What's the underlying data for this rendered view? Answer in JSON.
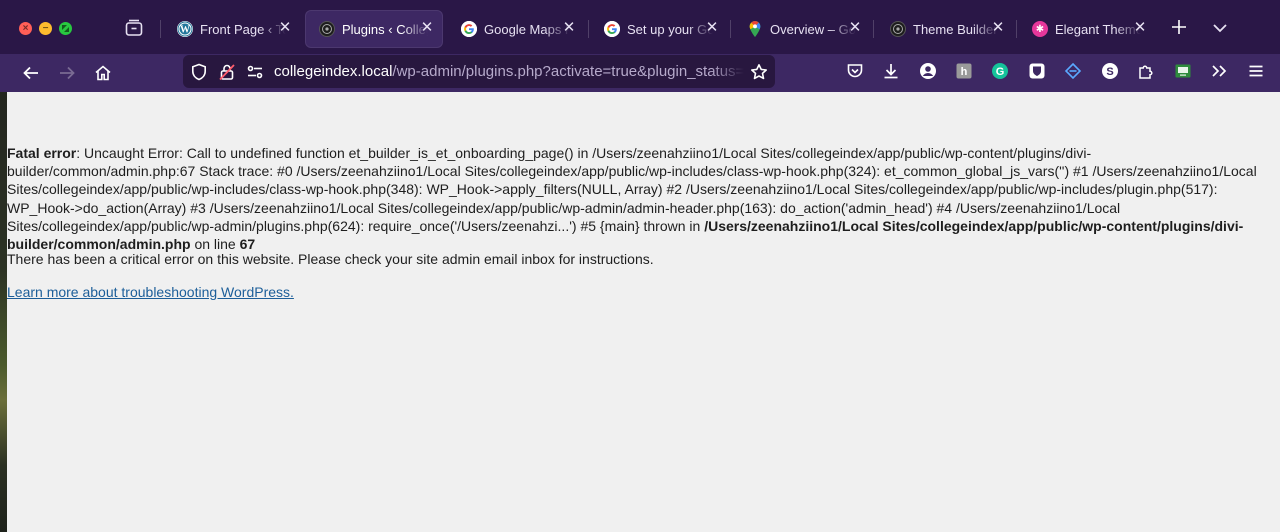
{
  "tabs": [
    {
      "label": "Front Page ‹ Temp",
      "icon": "wordpress-icon",
      "active": false
    },
    {
      "label": "Plugins ‹ College",
      "icon": "theme-icon",
      "active": true
    },
    {
      "label": "Google Maps Pla",
      "icon": "google-icon",
      "active": false
    },
    {
      "label": "Set up your Goo",
      "icon": "google-icon",
      "active": false
    },
    {
      "label": "Overview – Goo",
      "icon": "maps-pin-icon",
      "active": false
    },
    {
      "label": "Theme Builder ‹",
      "icon": "theme-icon",
      "active": false
    },
    {
      "label": "Elegant Themes",
      "icon": "elegant-themes-icon",
      "active": false
    }
  ],
  "url": {
    "host": "collegeindex.local",
    "path": "/wp-admin/plugins.php?activate=true&plugin_status=all"
  },
  "error": {
    "label": "Fatal error",
    "message": ": Uncaught Error: Call to undefined function et_builder_is_et_onboarding_page() in /Users/zeenahziino1/Local Sites/collegeindex/app/public/wp-content/plugins/divi-builder/common/admin.php:67 Stack trace: #0 /Users/zeenahziino1/Local Sites/collegeindex/app/public/wp-includes/class-wp-hook.php(324): et_common_global_js_vars('') #1 /Users/zeenahziino1/Local Sites/collegeindex/app/public/wp-includes/class-wp-hook.php(348): WP_Hook->apply_filters(NULL, Array) #2 /Users/zeenahziino1/Local Sites/collegeindex/app/public/wp-includes/plugin.php(517): WP_Hook->do_action(Array) #3 /Users/zeenahziino1/Local Sites/collegeindex/app/public/wp-admin/admin-header.php(163): do_action('admin_head') #4 /Users/zeenahziino1/Local Sites/collegeindex/app/public/wp-admin/plugins.php(624): require_once('/Users/zeenahzi...') #5 {main} thrown in ",
    "file": "/Users/zeenahziino1/Local Sites/collegeindex/app/public/wp-content/plugins/divi-builder/common/admin.php",
    "on_line_text": " on line ",
    "line": "67"
  },
  "critical_message": "There has been a critical error on this website. Please check your site admin email inbox for instructions.",
  "learn_more": "Learn more about troubleshooting WordPress.",
  "colors": {
    "tabbar_bg": "#2a1747",
    "navbar_bg": "#3d2863",
    "page_bg": "#f0f0f0",
    "link": "#1c5e99"
  }
}
